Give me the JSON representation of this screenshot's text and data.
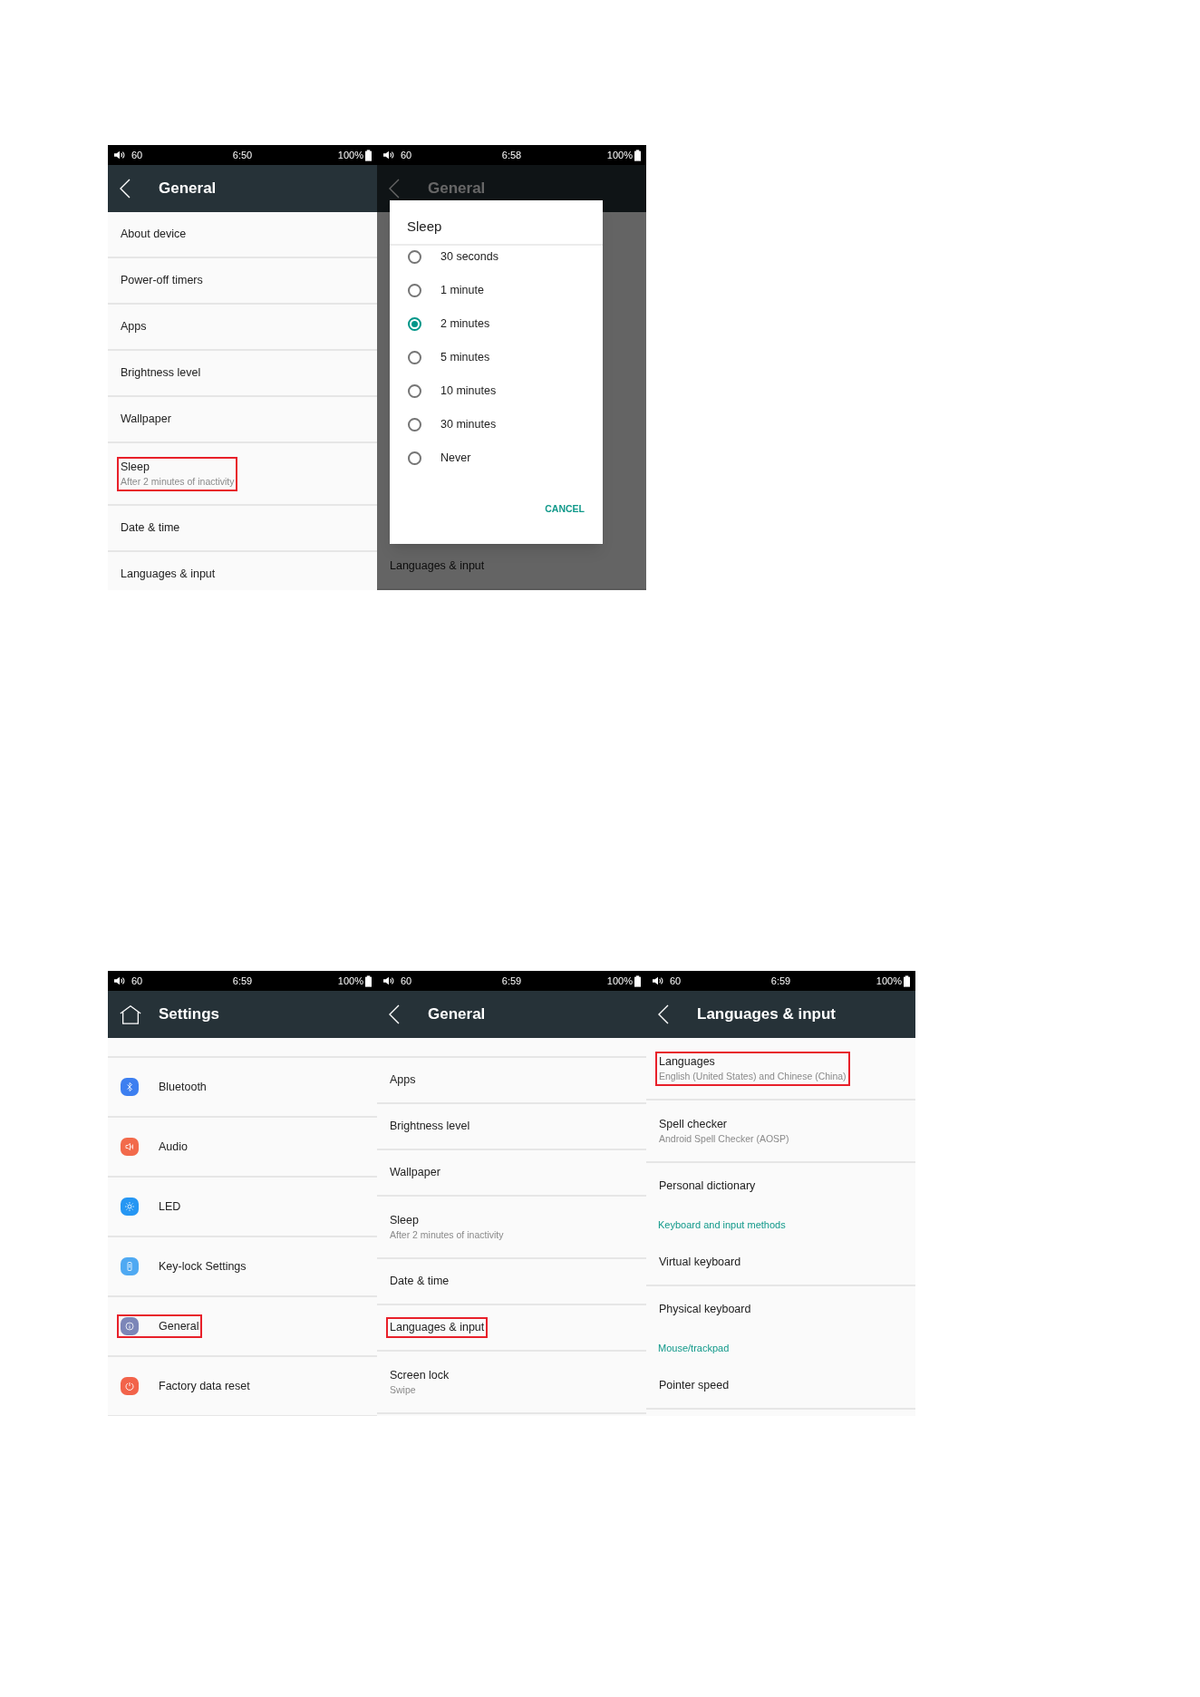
{
  "screens": [
    {
      "status_bar": {
        "volume": "60",
        "time": "6:50",
        "battery": "100%"
      },
      "header": {
        "title": "General"
      },
      "items": [
        {
          "kind": "row",
          "title": "About device",
          "highlighted": false
        },
        {
          "kind": "row",
          "title": "Power-off timers",
          "highlighted": false
        },
        {
          "kind": "row",
          "title": "Apps",
          "highlighted": false
        },
        {
          "kind": "row",
          "title": "Brightness level",
          "highlighted": false
        },
        {
          "kind": "row",
          "title": "Wallpaper",
          "highlighted": false
        },
        {
          "kind": "row",
          "title": "Sleep",
          "subtitle": "After 2 minutes of inactivity",
          "highlighted": true
        },
        {
          "kind": "row",
          "title": "Date & time",
          "highlighted": false
        },
        {
          "kind": "row",
          "title": "Languages & input",
          "highlighted": false
        }
      ]
    },
    {
      "status_bar": {
        "volume": "60",
        "time": "6:58",
        "battery": "100%"
      },
      "header": {
        "title": "General"
      },
      "items": [
        {
          "kind": "row",
          "title": "Languages & input",
          "highlighted": false
        }
      ],
      "dialog": {
        "title": "Sleep",
        "options": [
          {
            "label": "30 seconds",
            "selected": false
          },
          {
            "label": "1 minute",
            "selected": false
          },
          {
            "label": "2 minutes",
            "selected": true
          },
          {
            "label": "5 minutes",
            "selected": false
          },
          {
            "label": "10 minutes",
            "selected": false
          },
          {
            "label": "30 minutes",
            "selected": false
          },
          {
            "label": "Never",
            "selected": false
          }
        ],
        "button": "CANCEL"
      }
    },
    {
      "status_bar": {
        "volume": "60",
        "time": "6:59",
        "battery": "100%"
      },
      "header": {
        "title": "Settings"
      },
      "items": [
        {
          "kind": "icon_row",
          "color": "#3d7ff0",
          "title": "Bluetooth",
          "highlighted": false
        },
        {
          "kind": "icon_row",
          "color": "#f26a4b",
          "title": "Audio",
          "highlighted": false
        },
        {
          "kind": "icon_row",
          "color": "#2596f3",
          "title": "LED",
          "highlighted": false
        },
        {
          "kind": "icon_row",
          "color": "#4fa9f2",
          "title": "Key-lock Settings",
          "highlighted": false
        },
        {
          "kind": "icon_row",
          "color": "#7c86b8",
          "title": "General",
          "highlighted": true
        },
        {
          "kind": "icon_row",
          "color": "#f2634a",
          "title": "Factory data reset",
          "highlighted": false
        }
      ]
    },
    {
      "status_bar": {
        "volume": "60",
        "time": "6:59",
        "battery": "100%"
      },
      "header": {
        "title": "General"
      },
      "items": [
        {
          "kind": "row",
          "title": "Apps",
          "highlighted": false
        },
        {
          "kind": "row",
          "title": "Brightness level",
          "highlighted": false
        },
        {
          "kind": "row",
          "title": "Wallpaper",
          "highlighted": false
        },
        {
          "kind": "row",
          "title": "Sleep",
          "subtitle": "After 2 minutes of inactivity",
          "highlighted": false
        },
        {
          "kind": "row",
          "title": "Date & time",
          "highlighted": false
        },
        {
          "kind": "row",
          "title": "Languages & input",
          "highlighted": true
        },
        {
          "kind": "row",
          "title": "Screen lock",
          "subtitle": "Swipe",
          "highlighted": false
        }
      ]
    },
    {
      "status_bar": {
        "volume": "60",
        "time": "6:59",
        "battery": "100%"
      },
      "header": {
        "title": "Languages & input"
      },
      "items": [
        {
          "kind": "row",
          "title": "Languages",
          "subtitle": "English (United States) and Chinese (China)",
          "highlighted": true
        },
        {
          "kind": "row",
          "title": "Spell checker",
          "subtitle": "Android Spell Checker (AOSP)",
          "highlighted": false
        },
        {
          "kind": "row",
          "title": "Personal dictionary",
          "highlighted": false,
          "divider": false
        },
        {
          "kind": "category",
          "title": "Keyboard and input methods"
        },
        {
          "kind": "row",
          "title": "Virtual keyboard",
          "highlighted": false
        },
        {
          "kind": "row",
          "title": "Physical keyboard",
          "highlighted": false,
          "divider": false
        },
        {
          "kind": "category",
          "title": "Mouse/trackpad"
        },
        {
          "kind": "row",
          "title": "Pointer speed",
          "highlighted": false
        }
      ]
    }
  ]
}
